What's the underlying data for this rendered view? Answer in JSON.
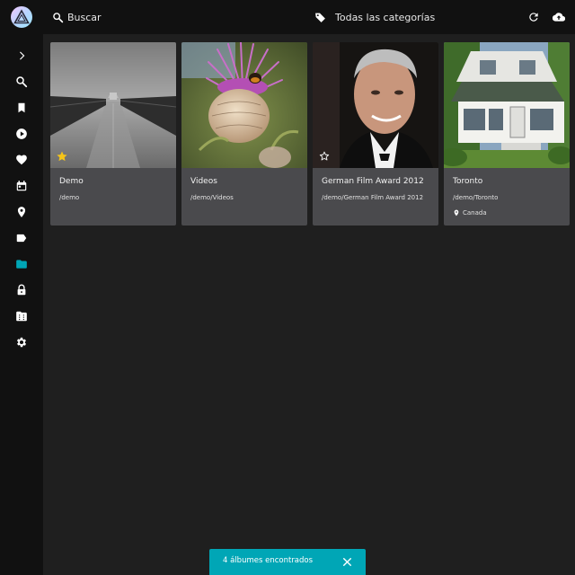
{
  "topbar": {
    "search_label": "Buscar",
    "category_label": "Todas las categorías"
  },
  "sidebar": {
    "items": [
      {
        "icon": "chevron-right-icon"
      },
      {
        "icon": "search-icon"
      },
      {
        "icon": "bookmark-icon"
      },
      {
        "icon": "play-circle-icon"
      },
      {
        "icon": "heart-icon"
      },
      {
        "icon": "calendar-icon"
      },
      {
        "icon": "map-marker-icon"
      },
      {
        "icon": "label-icon"
      },
      {
        "icon": "folder-icon",
        "active": true
      },
      {
        "icon": "lock-icon"
      },
      {
        "icon": "film-folder-icon"
      },
      {
        "icon": "gear-icon"
      }
    ]
  },
  "albums": [
    {
      "title": "Demo",
      "path": "/demo",
      "favorite": true,
      "location": ""
    },
    {
      "title": "Videos",
      "path": "/demo/Videos",
      "favorite": false,
      "location": ""
    },
    {
      "title": "German Film Award 2012",
      "path": "/demo/German Film Award 2012",
      "favorite": false,
      "location": ""
    },
    {
      "title": "Toronto",
      "path": "/demo/Toronto",
      "favorite": false,
      "location": "Canada"
    }
  ],
  "snackbar": {
    "message": "4 álbumes encontrados"
  },
  "colors": {
    "accent": "#00a6b6",
    "star_active": "#f5c518",
    "background": "#1f1f1f",
    "rail": "#111111",
    "card": "#4a4a4d"
  }
}
